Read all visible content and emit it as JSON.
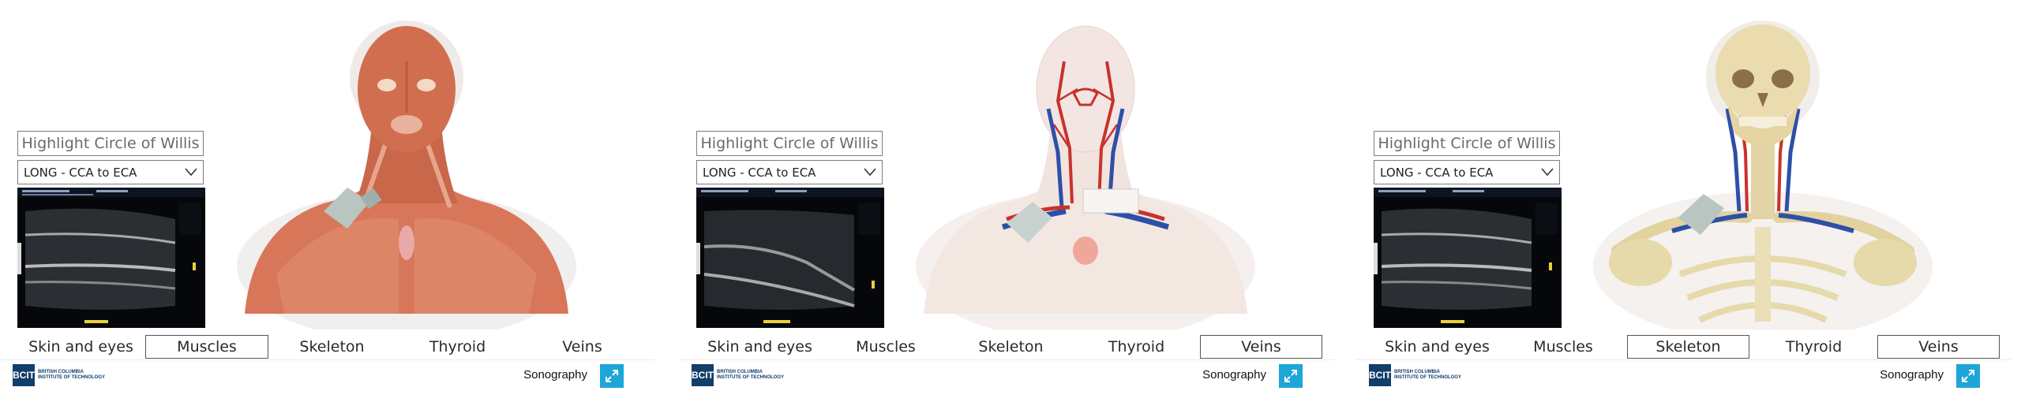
{
  "panels": [
    {
      "highlight_button": "Highlight Circle of Willis",
      "view_select": "LONG - CCA to ECA",
      "tabs": [
        "Skin and eyes",
        "Muscles",
        "Skeleton",
        "Thyroid",
        "Veins"
      ],
      "selected_tabs": [
        "Muscles"
      ],
      "layer": "muscles",
      "brand": "Sonography"
    },
    {
      "highlight_button": "Highlight Circle of Willis",
      "view_select": "LONG - CCA to ECA",
      "tabs": [
        "Skin and eyes",
        "Muscles",
        "Skeleton",
        "Thyroid",
        "Veins"
      ],
      "selected_tabs": [
        "Veins"
      ],
      "layer": "vessels",
      "brand": "Sonography"
    },
    {
      "highlight_button": "Highlight Circle of Willis",
      "view_select": "LONG - CCA to ECA",
      "tabs": [
        "Skin and eyes",
        "Muscles",
        "Skeleton",
        "Thyroid",
        "Veins"
      ],
      "selected_tabs": [
        "Skeleton",
        "Veins"
      ],
      "layer": "skeleton",
      "brand": "Sonography"
    }
  ],
  "logo": {
    "abbr": "BCIT",
    "line1": "BRITISH COLUMBIA",
    "line2": "INSTITUTE OF TECHNOLOGY"
  },
  "colors": {
    "accent": "#1ea6d8",
    "logo_blue": "#123e6a",
    "muscle": "#d9795a",
    "bone": "#e4d6a6",
    "artery": "#c8322d",
    "vein": "#2d4fa8"
  },
  "icons": {
    "dropdown": "chevron-down-icon",
    "expand": "expand-arrows-icon"
  }
}
